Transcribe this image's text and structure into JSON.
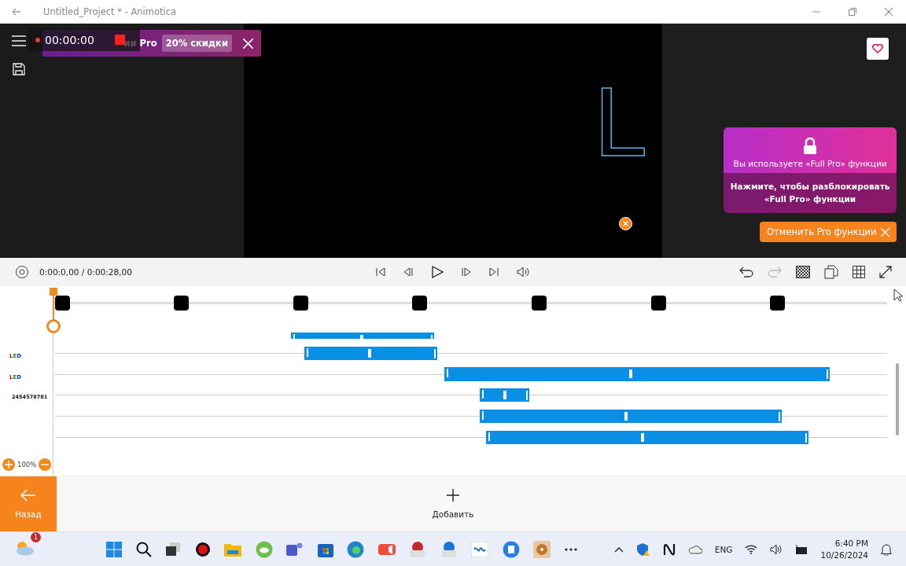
{
  "window": {
    "title": "Untitled_Project * - Animotica"
  },
  "recorder": {
    "time": "00:00:00"
  },
  "promo_banner": {
    "text": "ии Pro",
    "discount": "20% скидки"
  },
  "canvas": {
    "letter": "L"
  },
  "pro_panel": {
    "notice": "Вы используете «Full Pro» функции",
    "action": "Нажмите, чтобы разблокировать «Full Pro» функции",
    "cancel": "Отменить Pro функции"
  },
  "playback": {
    "time": "0:00:0,00 / 0:00:28,00"
  },
  "tracks": [
    {
      "label": "LED"
    },
    {
      "label": "LED"
    },
    {
      "label": "2454578781"
    }
  ],
  "zoom": {
    "text": "100%"
  },
  "bottom": {
    "back": "Назад",
    "add": "Добавить"
  },
  "taskbar": {
    "weather_badge": "1",
    "language": "ENG",
    "time": "6:40 PM",
    "date": "10/26/2024"
  }
}
